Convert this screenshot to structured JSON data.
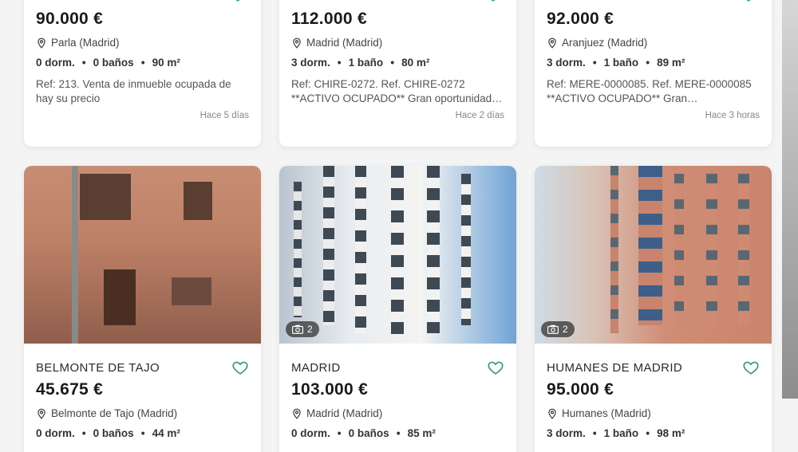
{
  "listings_top": [
    {
      "price": "90.000 €",
      "location": "Parla (Madrid)",
      "bedrooms": "0 dorm.",
      "bathrooms": "0 baños",
      "area": "90 m²",
      "description": "Ref: 213. Venta de inmueble ocupada de hay su precio",
      "date": "Hace 5 días"
    },
    {
      "price": "112.000 €",
      "location": "Madrid (Madrid)",
      "bedrooms": "3 dorm.",
      "bathrooms": "1 baño",
      "area": "80 m²",
      "description": "Ref: CHIRE-0272. Ref. CHIRE-0272 **ACTIVO OCUPADO** Gran oportunidad…",
      "date": "Hace 2 días"
    },
    {
      "price": "92.000 €",
      "location": "Aranjuez (Madrid)",
      "bedrooms": "3 dorm.",
      "bathrooms": "1 baño",
      "area": "89 m²",
      "description": "Ref: MERE-0000085. Ref. MERE-0000085 **ACTIVO OCUPADO** Gran…",
      "date": "Hace 3 horas"
    }
  ],
  "listings_bottom": [
    {
      "town": "BELMONTE DE TAJO",
      "price": "45.675 €",
      "location": "Belmonte de Tajo (Madrid)",
      "bedrooms": "0 dorm.",
      "bathrooms": "0 baños",
      "area": "44 m²",
      "photo_count": ""
    },
    {
      "town": "MADRID",
      "price": "103.000 €",
      "location": "Madrid (Madrid)",
      "bedrooms": "0 dorm.",
      "bathrooms": "0 baños",
      "area": "85 m²",
      "photo_count": "2"
    },
    {
      "town": "HUMANES DE MADRID",
      "price": "95.000 €",
      "location": "Humanes (Madrid)",
      "bedrooms": "3 dorm.",
      "bathrooms": "1 baño",
      "area": "98 m²",
      "photo_count": "2"
    }
  ],
  "colors": {
    "heart": "#2e9e6b",
    "badge_bg": "#3a3a3a"
  },
  "icons": {
    "favorite": "heart-outline-icon",
    "location": "map-pin-icon",
    "photos": "camera-icon"
  }
}
